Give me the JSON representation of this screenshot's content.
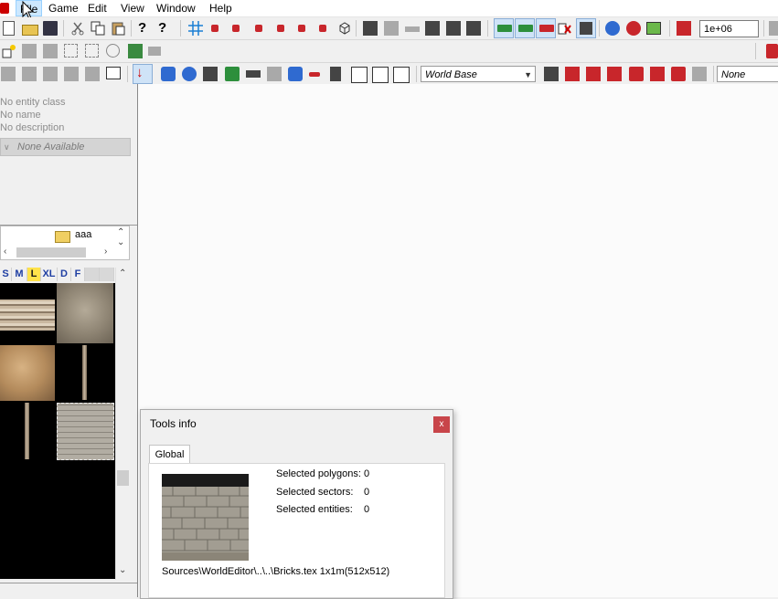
{
  "menu": {
    "items": [
      "File",
      "Game",
      "Edit",
      "View",
      "Window",
      "Help"
    ],
    "active": "File"
  },
  "toolbar": {
    "zoom_value": "1e+06",
    "world_base": "World Base",
    "entity_dropdown": "None Available"
  },
  "properties": {
    "entity_class": "No entity class",
    "name": "No name",
    "description": "No description",
    "dropdown": "None Available"
  },
  "tree": {
    "folder_label": "aaa"
  },
  "size_tabs": [
    "S",
    "M",
    "L",
    "XL",
    "D",
    "F"
  ],
  "size_tab_selected": "L",
  "tools_info": {
    "title": "Tools info",
    "close_label": "x",
    "tab": "Global",
    "stats": [
      {
        "label": "Selected polygons:",
        "value": "0"
      },
      {
        "label": "Selected sectors:",
        "value": "0"
      },
      {
        "label": "Selected entities:",
        "value": "0"
      }
    ],
    "texture_path": "Sources\\WorldEditor\\..\\..\\Bricks.tex  1x1m(512x512)"
  },
  "icon_names": [
    "new-document-icon",
    "open-folder-icon",
    "save-icon",
    "cut-icon",
    "copy-icon",
    "paste-icon",
    "help-icon",
    "context-help-icon",
    "grid-icon",
    "globe-icon",
    "layers-icon"
  ]
}
